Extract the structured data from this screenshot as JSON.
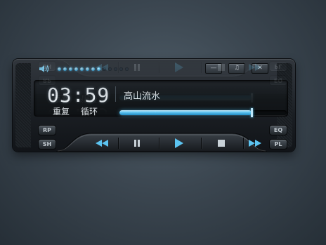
{
  "player": {
    "time": "03:59",
    "track_title": "高山流水",
    "repeat_label": "重复",
    "loop_label": "循环",
    "volume": {
      "total_dots": 13,
      "active_dots": 8
    },
    "progress": 0.79,
    "side_buttons": {
      "rp": "RP",
      "sh": "SH",
      "eq": "EQ",
      "pl": "PL"
    },
    "window_buttons": [
      {
        "name": "minimize",
        "glyph": "—"
      },
      {
        "name": "music",
        "glyph": "♫"
      },
      {
        "name": "close",
        "glyph": "✕"
      }
    ],
    "transport": [
      "previous-icon",
      "pause-icon",
      "play-icon",
      "stop-icon",
      "next-icon"
    ],
    "colors": {
      "accent": "#5cc4f1",
      "accent_light": "#c9f0ff",
      "text": "#e8eef2"
    }
  }
}
